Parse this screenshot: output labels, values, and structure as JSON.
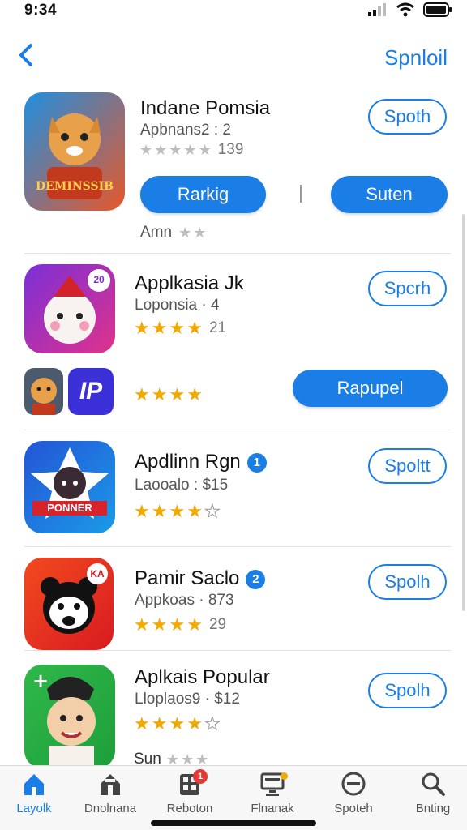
{
  "status_bar": {
    "time": "9:34"
  },
  "nav": {
    "action_label": "Spnloil"
  },
  "apps": [
    {
      "title": "Indane Pomsia",
      "subtitle": "Apbnans2 : 2",
      "rating_stars": 0,
      "rating_count": "139",
      "primary_button": "Spoth",
      "action_left": "Rarkig",
      "action_right": "Suten",
      "extra_label": "Amn",
      "icon_text": "DEMINSSIB",
      "colors": {
        "bg1": "#1f8fe0",
        "bg2": "#e7572a"
      }
    },
    {
      "title": "Applkasia Jk",
      "subtitle": "Loponsia · 4",
      "rating_stars": 4,
      "rating_count": "21",
      "primary_button": "Spcrh",
      "icon_badge": "20",
      "row_stars": 4,
      "row_button": "Rapupel",
      "mini_icon_text": "IP",
      "colors": {
        "bg1": "#7b2fd8",
        "bg2": "#e0328a"
      }
    },
    {
      "title": "Apdlinn Rgn",
      "badge": "1",
      "subtitle": "Laooalo : $15",
      "rating_stars": 4,
      "rating_count": "",
      "primary_button": "Spoltt",
      "icon_text": "PONNER",
      "colors": {
        "bg1": "#2454d6",
        "bg2": "#1a9be8"
      }
    },
    {
      "title": "Pamir Saclo",
      "badge": "2",
      "subtitle": "Appkoas · 873",
      "rating_stars": 4,
      "rating_count": "29",
      "primary_button": "Spolh",
      "icon_badge": "KA",
      "colors": {
        "bg1": "#f24a1f",
        "bg2": "#d81b20"
      }
    },
    {
      "title": "Aplkais Popular",
      "subtitle": "Lloplaos9 · $12",
      "rating_stars": 4,
      "rating_count": "",
      "primary_button": "Spolh",
      "extra_label": "Sun",
      "colors": {
        "bg1": "#2fb84a",
        "bg2": "#1e9e3a"
      }
    }
  ],
  "tabs": [
    {
      "label": "Layolk",
      "icon": "home-icon",
      "active": true
    },
    {
      "label": "Dnolnana",
      "icon": "house-icon"
    },
    {
      "label": "Reboton",
      "icon": "games-icon",
      "badge": "1"
    },
    {
      "label": "Flnanak",
      "icon": "monitor-icon"
    },
    {
      "label": "Spoteh",
      "icon": "compass-icon"
    },
    {
      "label": "Bnting",
      "icon": "search-icon"
    }
  ],
  "theme": {
    "accent": "#1a7ee6",
    "star": "#f2a900",
    "badge_red": "#e53935"
  }
}
